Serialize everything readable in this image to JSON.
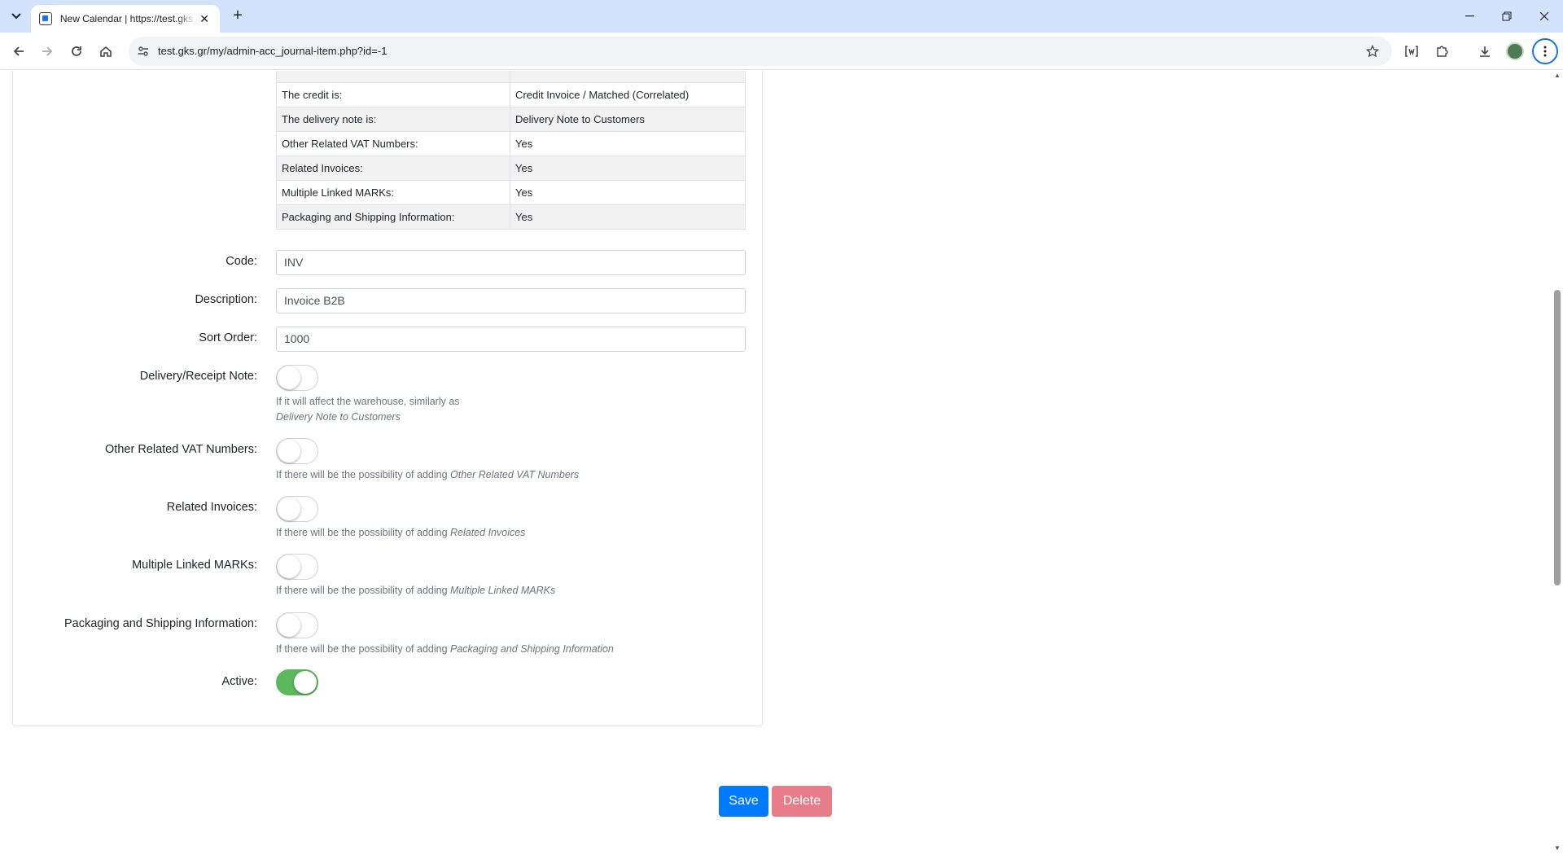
{
  "browser": {
    "tab_title": "New Calendar | https://test.gks.gr",
    "tab_close": "✕",
    "new_tab": "+",
    "url": "test.gks.gr/my/admin-acc_journal-item.php?id=-1"
  },
  "summary_table": [
    {
      "label": "The credit is:",
      "value": "Credit Invoice / Matched (Correlated)"
    },
    {
      "label": "The delivery note is:",
      "value": "Delivery Note to Customers"
    },
    {
      "label": "Other Related VAT Numbers:",
      "value": "Yes"
    },
    {
      "label": "Related Invoices:",
      "value": "Yes"
    },
    {
      "label": "Multiple Linked MARKs:",
      "value": "Yes"
    },
    {
      "label": "Packaging and Shipping Information:",
      "value": "Yes"
    }
  ],
  "form": {
    "code": {
      "label": "Code:",
      "value": "INV"
    },
    "description": {
      "label": "Description:",
      "value": "Invoice B2B"
    },
    "sort_order": {
      "label": "Sort Order:",
      "value": "1000"
    },
    "delivery_note": {
      "label": "Delivery/Receipt Note:",
      "checked": false,
      "help_line1": "If it will affect the warehouse, similarly as",
      "help_line2": "Delivery Note to Customers"
    },
    "other_vat": {
      "label": "Other Related VAT Numbers:",
      "checked": false,
      "help_prefix": "If there will be the possibility of adding ",
      "help_em": "Other Related VAT Numbers"
    },
    "related_invoices": {
      "label": "Related Invoices:",
      "checked": false,
      "help_prefix": "If there will be the possibility of adding ",
      "help_em": "Related Invoices"
    },
    "linked_marks": {
      "label": "Multiple Linked MARKs:",
      "checked": false,
      "help_prefix": "If there will be the possibility of adding ",
      "help_em": "Multiple Linked MARKs"
    },
    "packaging": {
      "label": "Packaging and Shipping Information:",
      "checked": false,
      "help_prefix": "If there will be the possibility of adding ",
      "help_em": "Packaging and Shipping Information"
    },
    "active": {
      "label": "Active:",
      "checked": true
    }
  },
  "actions": {
    "save": "Save",
    "delete": "Delete"
  },
  "colors": {
    "save_button": "#007bff",
    "delete_button": "#e87d8a",
    "switch_on": "#5cb85c",
    "tabbar": "#d3e3fd"
  }
}
